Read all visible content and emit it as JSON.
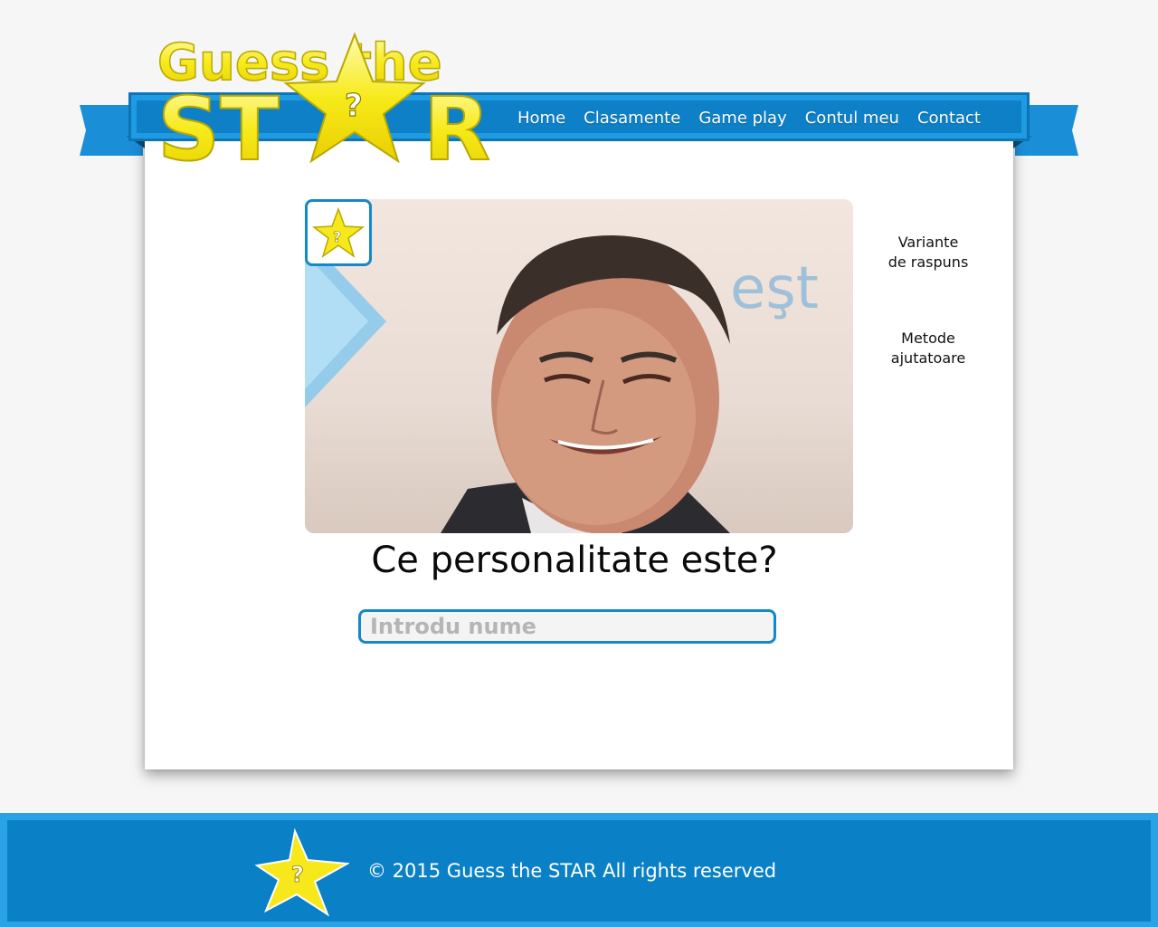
{
  "logo": {
    "line1": "Guess the",
    "line2_left": "ST",
    "line2_right": "R",
    "star_mark": "?"
  },
  "nav": {
    "items": [
      {
        "label": "Home"
      },
      {
        "label": "Clasamente"
      },
      {
        "label": "Game play"
      },
      {
        "label": "Contul meu"
      },
      {
        "label": "Contact"
      }
    ]
  },
  "game": {
    "badge_icon": "star-question-icon",
    "badge_mark": "?",
    "photo_icon": "celebrity-photo",
    "question": "Ce personalitate este?",
    "input_placeholder": "Introdu nume",
    "input_value": ""
  },
  "sidebar": {
    "answer_options": {
      "line1": "Variante",
      "line2": "de raspuns"
    },
    "helpers": {
      "line1": "Metode",
      "line2": "ajutatoare"
    }
  },
  "footer": {
    "star_mark": "?",
    "copyright": "© 2015 Guess the STAR All rights reserved"
  },
  "colors": {
    "brand_blue": "#0d80c8",
    "accent_yellow": "#f5e61e",
    "border_blue": "#1588cc"
  }
}
